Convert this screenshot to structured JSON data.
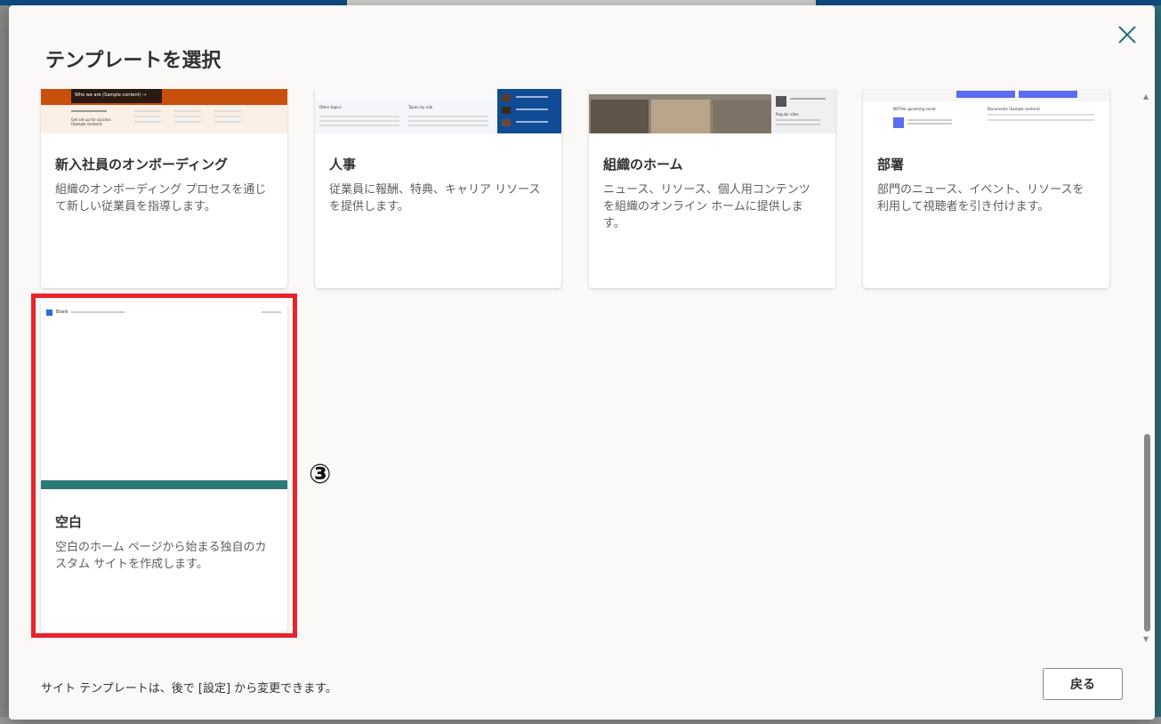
{
  "dialog": {
    "title": "テンプレートを選択",
    "footer_note": "サイト テンプレートは、後で [設定] から変更できます。",
    "back_label": "戻る",
    "annotation": "③"
  },
  "cards": [
    {
      "title": "新入社員のオンボーディング",
      "description": "組織のオンボーディング プロセスを通じて新しい従業員を指導します。",
      "thumb_text": [
        "Who we are (Sample content) →",
        "Get set up for success (Sample content)"
      ]
    },
    {
      "title": "人事",
      "description": "従業員に報酬、特典、キャリア リソースを提供します。",
      "thumb_text": [
        "Other topics",
        "Topics by role"
      ]
    },
    {
      "title": "組織のホーム",
      "description": "ニュース、リソース、個人用コンテンツを組織のオンライン ホームに提供します。",
      "thumb_text": [
        "Popular sites"
      ]
    },
    {
      "title": "部署",
      "description": "部門のニュース、イベント、リソースを利用して視聴者を引き付けます。",
      "thumb_text": [
        "NOTHe upcoming event",
        "Documents (Sample content)"
      ]
    },
    {
      "title": "空白",
      "description": "空白のホーム ページから始まる独自のカスタム サイトを作成します。",
      "thumb_text": [
        "Blank"
      ]
    }
  ],
  "colors": {
    "accent": "#2b7a78",
    "highlight": "#e8232b",
    "onboarding_orange": "#c94f0c",
    "hr_blue": "#0f4c95"
  }
}
